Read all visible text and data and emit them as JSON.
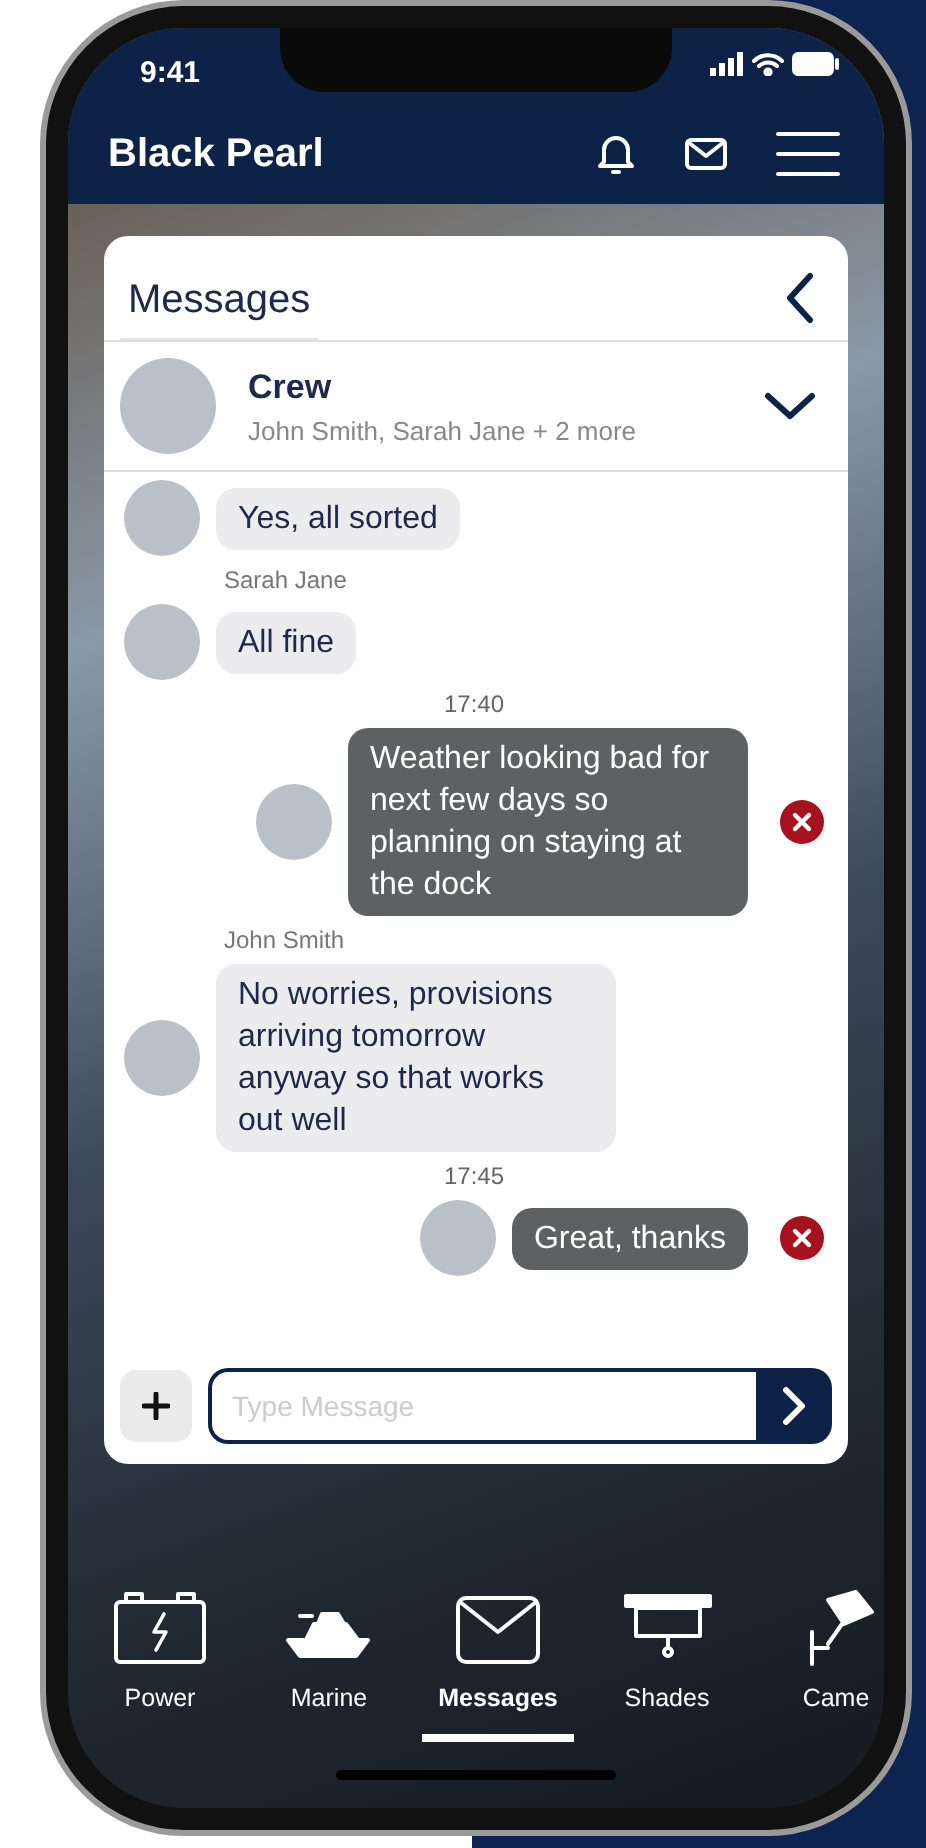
{
  "status_bar": {
    "time": "9:41"
  },
  "header": {
    "title": "Black Pearl"
  },
  "tabs": [
    {
      "label": "Messages",
      "selected": true
    }
  ],
  "conversation": {
    "name": "Crew",
    "members": "John Smith, Sarah Jane + 2 more",
    "expanded": false
  },
  "messages": [
    {
      "kind": "received",
      "text": "Yes, all sorted"
    },
    {
      "kind": "received",
      "sender": "Sarah Jane",
      "text": "All fine"
    },
    {
      "kind": "time",
      "text": "17:40"
    },
    {
      "kind": "sent",
      "text": "Weather looking bad for next few days so planning on staying at the dock"
    },
    {
      "kind": "received",
      "sender": "John Smith",
      "text": "No worries, provisions arriving tomorrow anyway so that works out well"
    },
    {
      "kind": "time",
      "text": "17:45"
    },
    {
      "kind": "sent",
      "text": "Great, thanks"
    }
  ],
  "composer": {
    "placeholder": "Type Message"
  },
  "bottom_nav": [
    {
      "label": "Power",
      "selected": false
    },
    {
      "label": "Marine",
      "selected": false
    },
    {
      "label": "Messages",
      "selected": true
    },
    {
      "label": "Shades",
      "selected": false
    },
    {
      "label": "Came",
      "selected": false
    }
  ]
}
